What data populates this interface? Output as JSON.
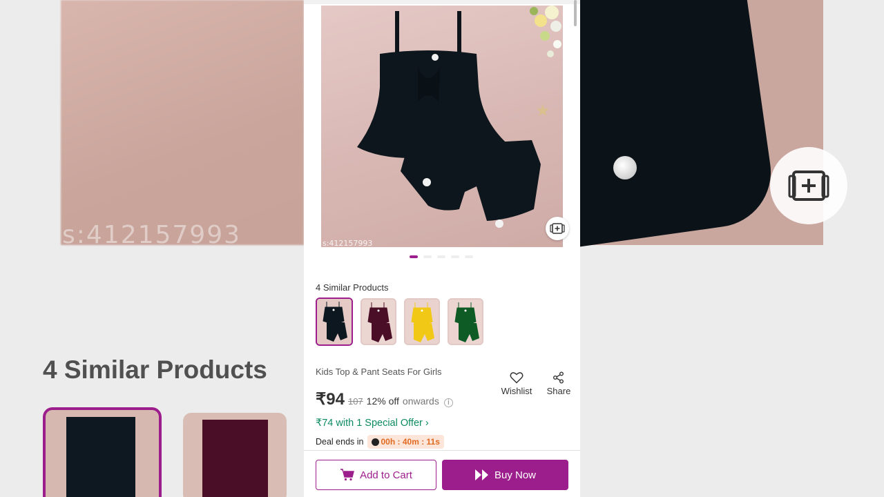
{
  "background": {
    "watermark": "s:412157993",
    "similar_heading": "4 Similar Products"
  },
  "product": {
    "image_watermark": "s:412157993",
    "similar_title": "4 Similar Products",
    "thumbnails": [
      {
        "color": "#0d1720",
        "selected": true
      },
      {
        "color": "#4a0e27",
        "selected": false
      },
      {
        "color": "#f1c816",
        "selected": false
      },
      {
        "color": "#0e5b25",
        "selected": false
      }
    ],
    "name": "Kids Top & Pant Seats  For Girls",
    "price": "₹94",
    "mrp": "107",
    "discount": "12% off",
    "onwards": "onwards",
    "info_icon": "i",
    "wishlist_label": "Wishlist",
    "share_label": "Share",
    "special_offer": "₹74 with 1 Special Offer ›",
    "deal_label": "Deal ends in",
    "deal_timer": "00h : 40m : 11s"
  },
  "actions": {
    "add_to_cart": "Add to Cart",
    "buy_now": "Buy Now"
  },
  "colors": {
    "accent": "#9c1e8c",
    "offer_green": "#0b8a61",
    "timer_orange": "#e06a20"
  }
}
